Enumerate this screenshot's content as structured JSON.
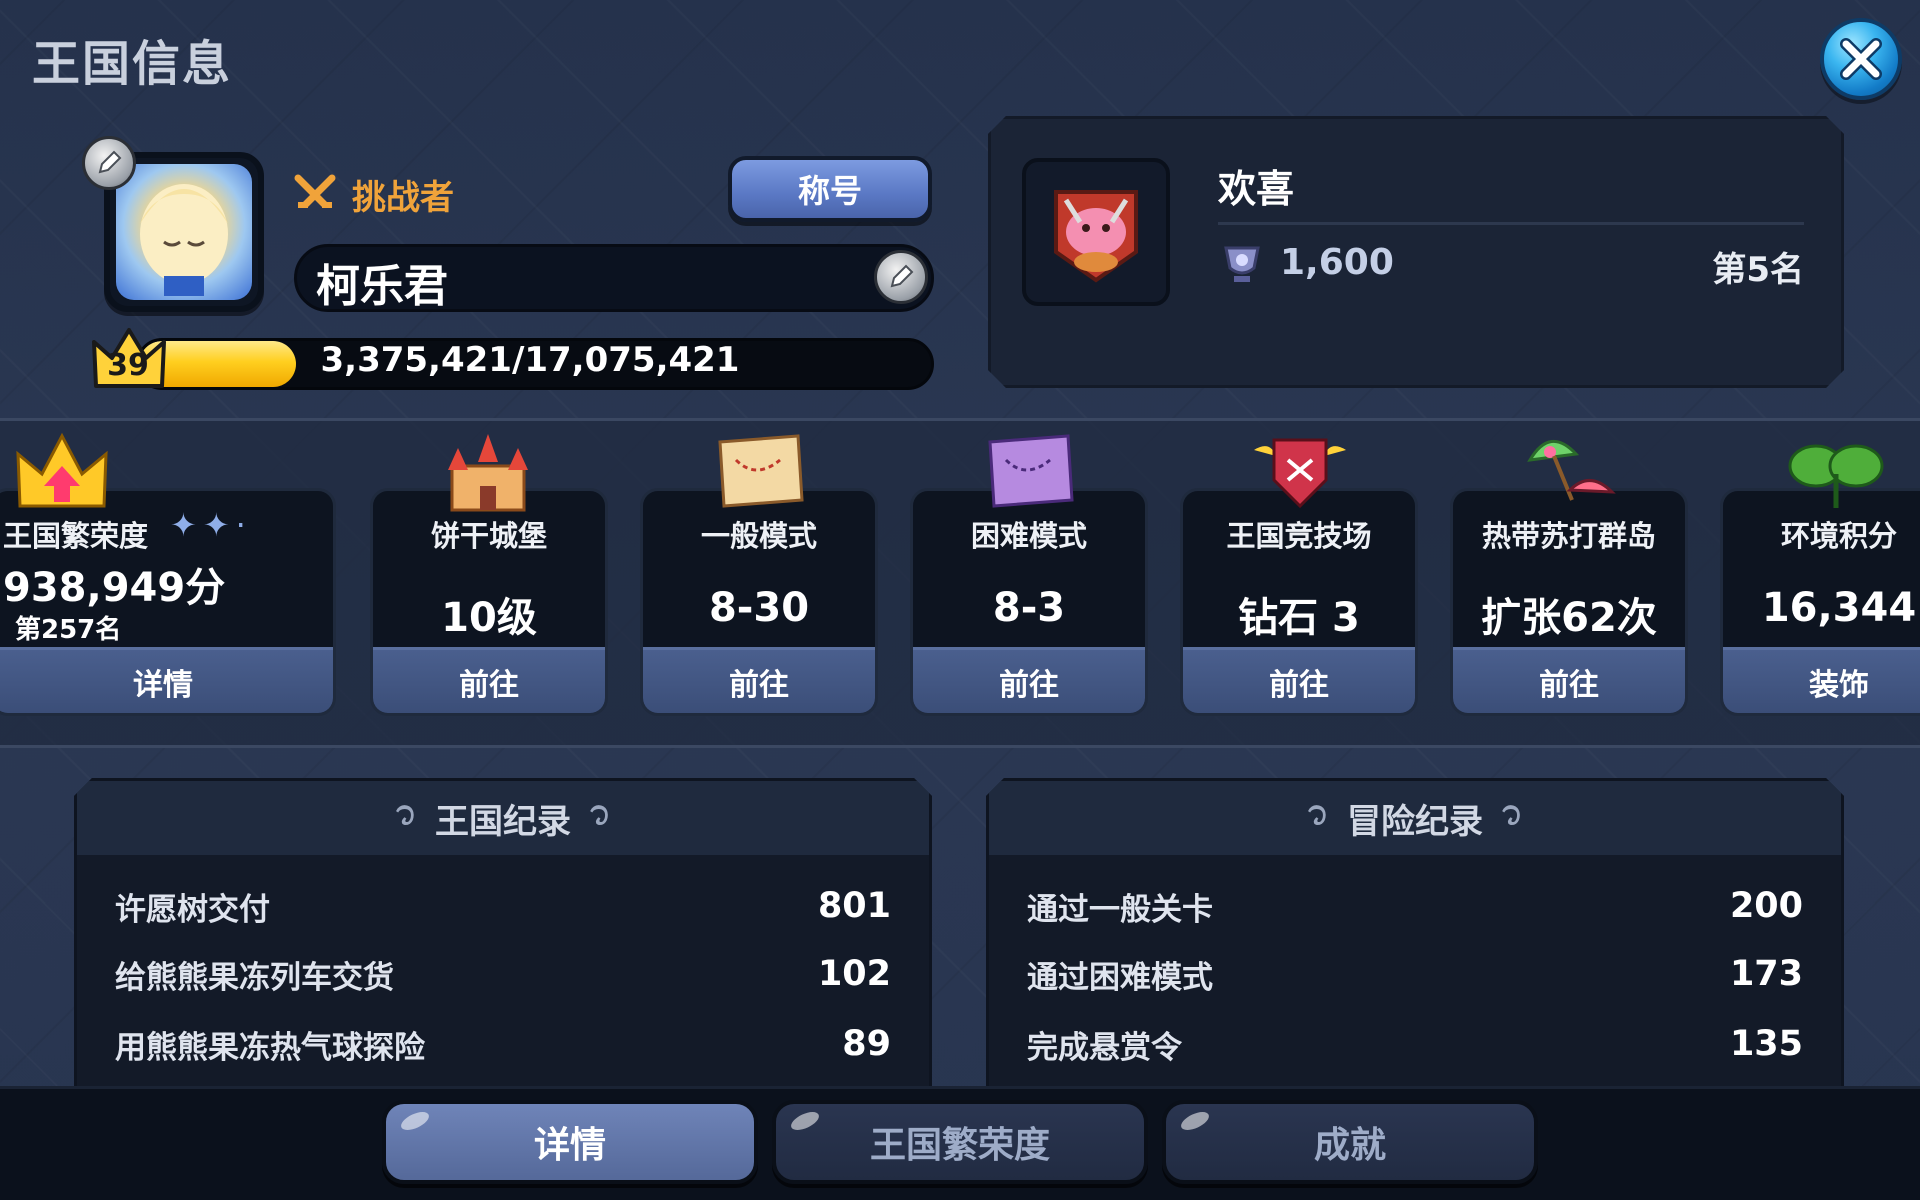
{
  "header": {
    "title": "王国信息",
    "close_icon": "close-icon"
  },
  "profile": {
    "rank_label": "挑战者",
    "title_button": "称号",
    "name": "柯乐君",
    "level": "39",
    "xp_text": "3,375,421/17,075,421",
    "xp_fraction": 0.198
  },
  "event": {
    "name": "欢喜",
    "score": "1,600",
    "rank": "第5名"
  },
  "stats": [
    {
      "label": "王国繁荣度",
      "value": "938,949分",
      "rank": "第257名",
      "button": "详情",
      "icon": "crown-icon"
    },
    {
      "label": "饼干城堡",
      "value": "10级",
      "button": "前往",
      "icon": "castle-icon"
    },
    {
      "label": "一般模式",
      "value": "8-30",
      "button": "前往",
      "icon": "map-icon"
    },
    {
      "label": "困难模式",
      "value": "8-3",
      "button": "前往",
      "icon": "hard-map-icon"
    },
    {
      "label": "王国竞技场",
      "value": "钻石 3",
      "button": "前往",
      "icon": "arena-shield-icon"
    },
    {
      "label": "热带苏打群岛",
      "value": "扩张62次",
      "button": "前往",
      "icon": "tropical-island-icon"
    },
    {
      "label": "环境积分",
      "value": "16,344",
      "button": "装饰",
      "icon": "clover-icon"
    }
  ],
  "kingdom_records": {
    "title": "王国纪录",
    "rows": [
      {
        "label": "许愿树交付",
        "value": "801"
      },
      {
        "label": "给熊熊果冻列车交货",
        "value": "102"
      },
      {
        "label": "用熊熊果冻热气球探险",
        "value": "89"
      }
    ]
  },
  "adventure_records": {
    "title": "冒险纪录",
    "rows": [
      {
        "label": "通过一般关卡",
        "value": "200"
      },
      {
        "label": "通过困难模式",
        "value": "173"
      },
      {
        "label": "完成悬赏令",
        "value": "135"
      }
    ]
  },
  "tabs": [
    {
      "label": "详情",
      "active": true
    },
    {
      "label": "王国繁荣度",
      "active": false
    },
    {
      "label": "成就",
      "active": false
    }
  ],
  "colors": {
    "accent_orange": "#f0a33a",
    "xp_yellow": "#ffcf1f",
    "button_blue": "#5a78c4"
  }
}
